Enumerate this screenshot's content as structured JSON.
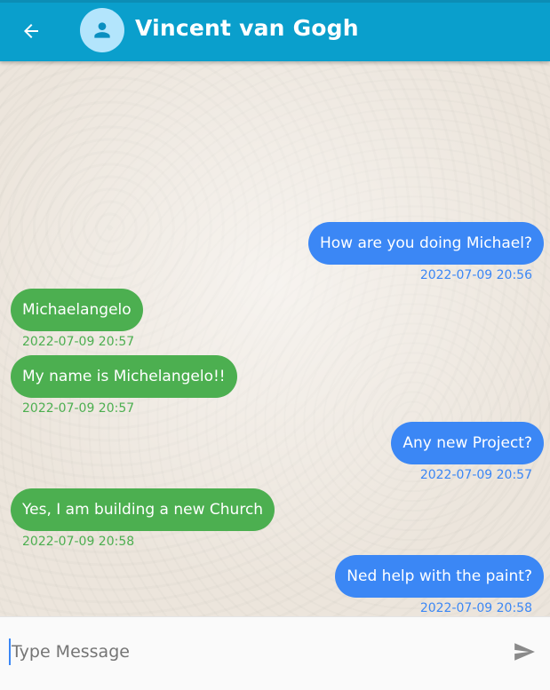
{
  "header": {
    "back_icon": "arrow-left-icon",
    "avatar_icon": "person-icon",
    "contact_name": "Vincent van Gogh",
    "bar_color": "#0a9fcc"
  },
  "messages": [
    {
      "direction": "sent",
      "text": "How are you doing Michael?",
      "time": "2022-07-09 20:56"
    },
    {
      "direction": "received",
      "text": "Michaelangelo",
      "time": "2022-07-09 20:57"
    },
    {
      "direction": "received",
      "text": "My name is Michelangelo!!",
      "time": "2022-07-09 20:57"
    },
    {
      "direction": "sent",
      "text": "Any new Project?",
      "time": "2022-07-09 20:57"
    },
    {
      "direction": "received",
      "text": "Yes, I am building a new Church",
      "time": "2022-07-09 20:58"
    },
    {
      "direction": "sent",
      "text": "Ned help with the paint?",
      "time": "2022-07-09 20:58"
    }
  ],
  "colors": {
    "sent_bubble": "#3b87f5",
    "received_bubble": "#4caf50"
  },
  "composer": {
    "placeholder": "Type Message",
    "value": "",
    "send_icon": "send-icon"
  }
}
